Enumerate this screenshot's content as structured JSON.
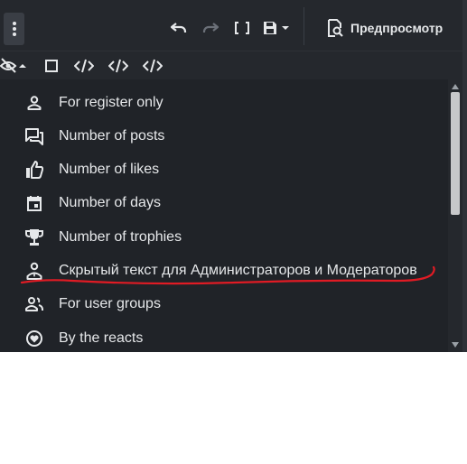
{
  "toolbar": {
    "menu_icon": "vertical-dots-icon",
    "undo_icon": "undo-icon",
    "redo_icon": "redo-icon",
    "brackets_icon": "brackets-icon",
    "save_icon": "save-icon",
    "preview_label": "Предпросмотр",
    "preview_icon": "preview-icon"
  },
  "subtoolbar": {
    "icons": [
      "visibility-off-icon",
      "square-icon",
      "code-icon",
      "code-icon",
      "code-icon"
    ]
  },
  "menu": {
    "items": [
      {
        "label": "For register only",
        "icon": "person-icon"
      },
      {
        "label": "Number of posts",
        "icon": "comments-icon"
      },
      {
        "label": "Number of likes",
        "icon": "thumbs-up-icon"
      },
      {
        "label": "Number of days",
        "icon": "calendar-icon"
      },
      {
        "label": "Number of trophies",
        "icon": "trophy-icon"
      },
      {
        "label": "Скрытый текст для Администраторов и Модераторов",
        "icon": "user-tie-icon"
      },
      {
        "label": "For user groups",
        "icon": "users-icon"
      },
      {
        "label": "By the reacts",
        "icon": "heart-circle-icon"
      }
    ]
  },
  "colors": {
    "background": "#202328",
    "toolbar": "#25282d",
    "text": "#e6e8ea",
    "annotation": "#e01b24"
  }
}
